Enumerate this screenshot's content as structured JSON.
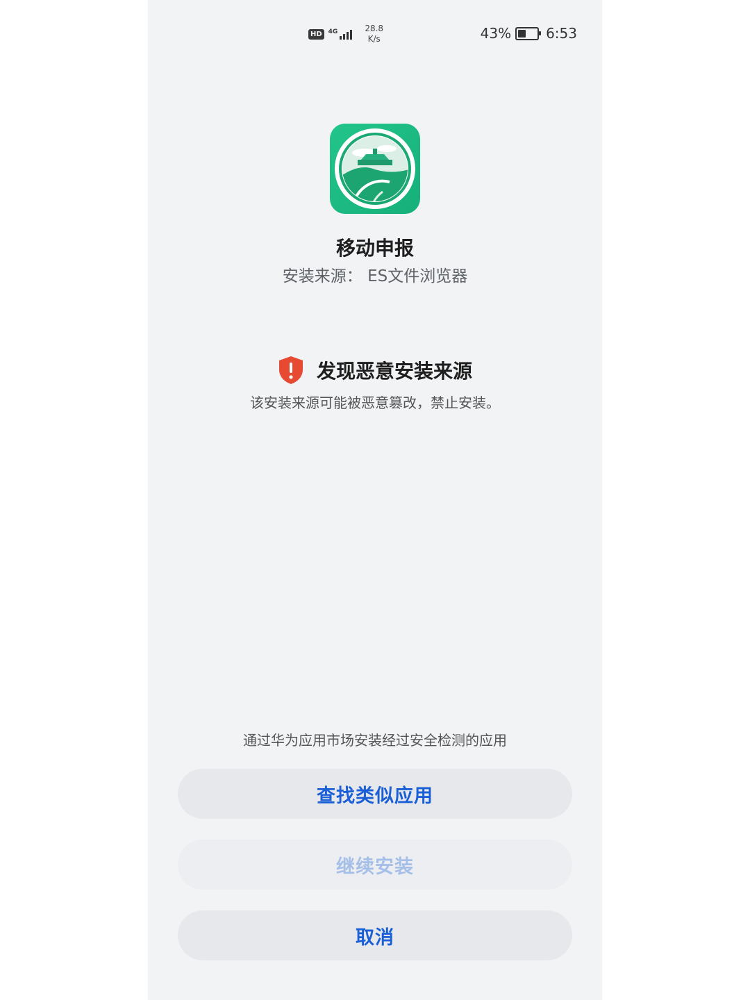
{
  "status_bar": {
    "hd": "HD",
    "network": "4G",
    "speed_value": "28.8",
    "speed_unit": "K/s",
    "battery_percent": "43%",
    "battery_level": 0.43,
    "time": "6:53"
  },
  "app": {
    "icon": "mobile-declare-app-icon",
    "name": "移动申报",
    "source": "安装来源： ES文件浏览器"
  },
  "warning": {
    "icon": "shield-alert-icon",
    "title": "发现恶意安装来源",
    "description": "该安装来源可能被恶意篡改，禁止安装。"
  },
  "hint": "通过华为应用市场安装经过安全检测的应用",
  "buttons": {
    "find_similar": "查找类似应用",
    "continue_install": "继续安装",
    "cancel": "取消"
  },
  "colors": {
    "background": "#f1f3f5",
    "accent": "#1a5fd6",
    "disabled": "#a5bfe8",
    "danger": "#e64a33",
    "icon_green": "#1fbf86"
  }
}
